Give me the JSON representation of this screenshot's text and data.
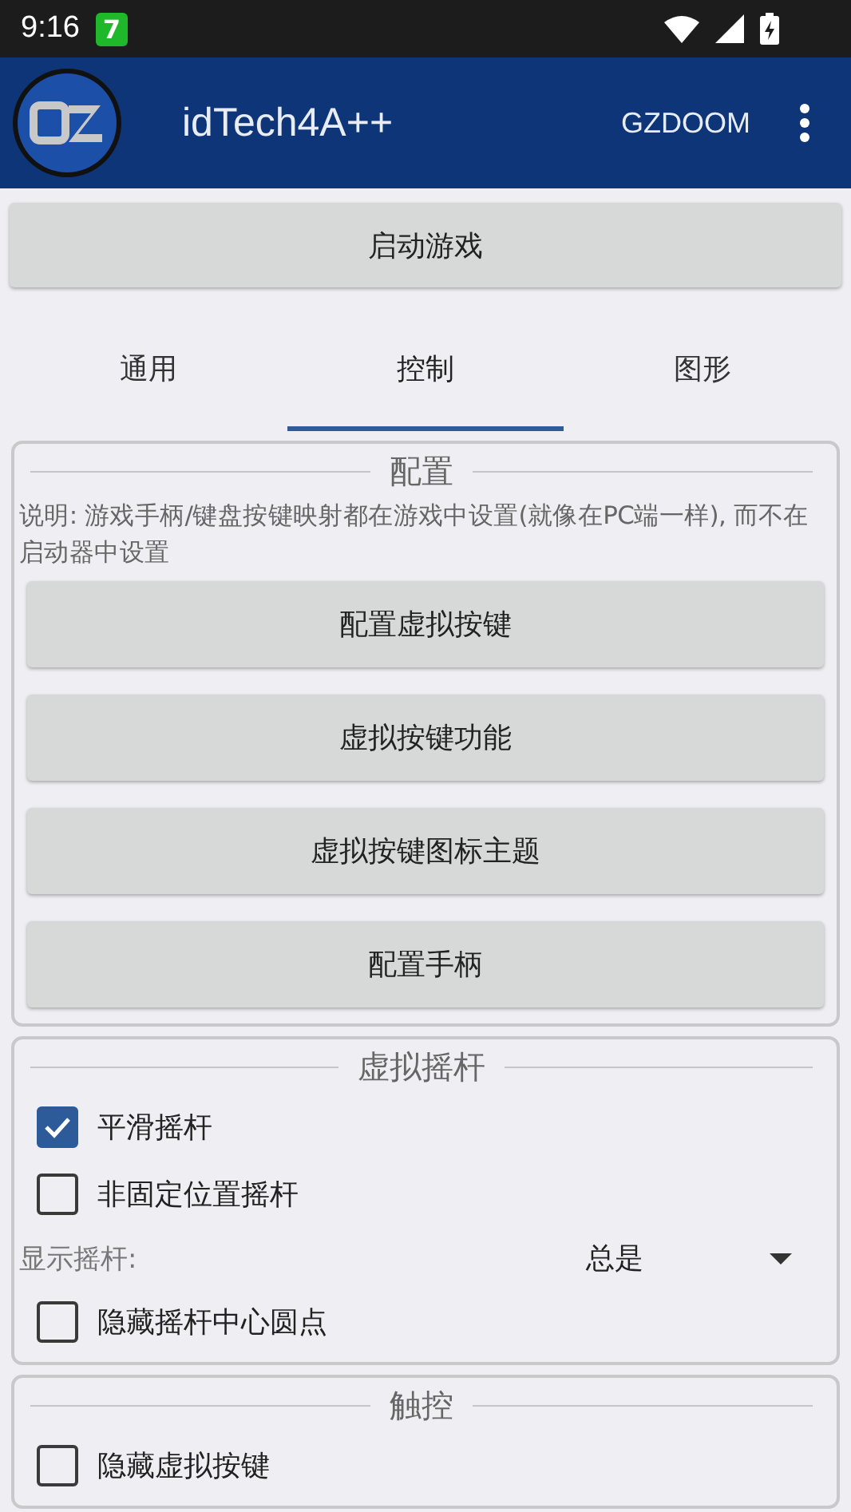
{
  "status_bar": {
    "time": "9:16",
    "badge": "7"
  },
  "app_bar": {
    "title": "idTech4A++",
    "action": "GZDOOM"
  },
  "launch_button": "启动游戏",
  "tabs": [
    {
      "label": "通用",
      "selected": false
    },
    {
      "label": "控制",
      "selected": true
    },
    {
      "label": "图形",
      "selected": false
    }
  ],
  "sections": [
    {
      "title": "配置",
      "items": [
        {
          "kind": "note",
          "text": "说明: 游戏手柄/键盘按键映射都在游戏中设置(就像在PC端一样), 而不在启动器中设置"
        },
        {
          "kind": "button",
          "text": "配置虚拟按键"
        },
        {
          "kind": "button",
          "text": "虚拟按键功能"
        },
        {
          "kind": "button",
          "text": "虚拟按键图标主题"
        },
        {
          "kind": "button",
          "text": "配置手柄"
        }
      ]
    },
    {
      "title": "虚拟摇杆",
      "items": [
        {
          "kind": "checkbox",
          "text": "平滑摇杆",
          "checked": true
        },
        {
          "kind": "checkbox",
          "text": "非固定位置摇杆",
          "checked": false
        },
        {
          "kind": "spinner",
          "text": "显示摇杆:",
          "value": "总是"
        },
        {
          "kind": "checkbox",
          "text": "隐藏摇杆中心圆点",
          "checked": false
        }
      ]
    },
    {
      "title": "触控",
      "items": [
        {
          "kind": "checkbox",
          "text": "隐藏虚拟按键",
          "checked": false
        }
      ]
    }
  ]
}
